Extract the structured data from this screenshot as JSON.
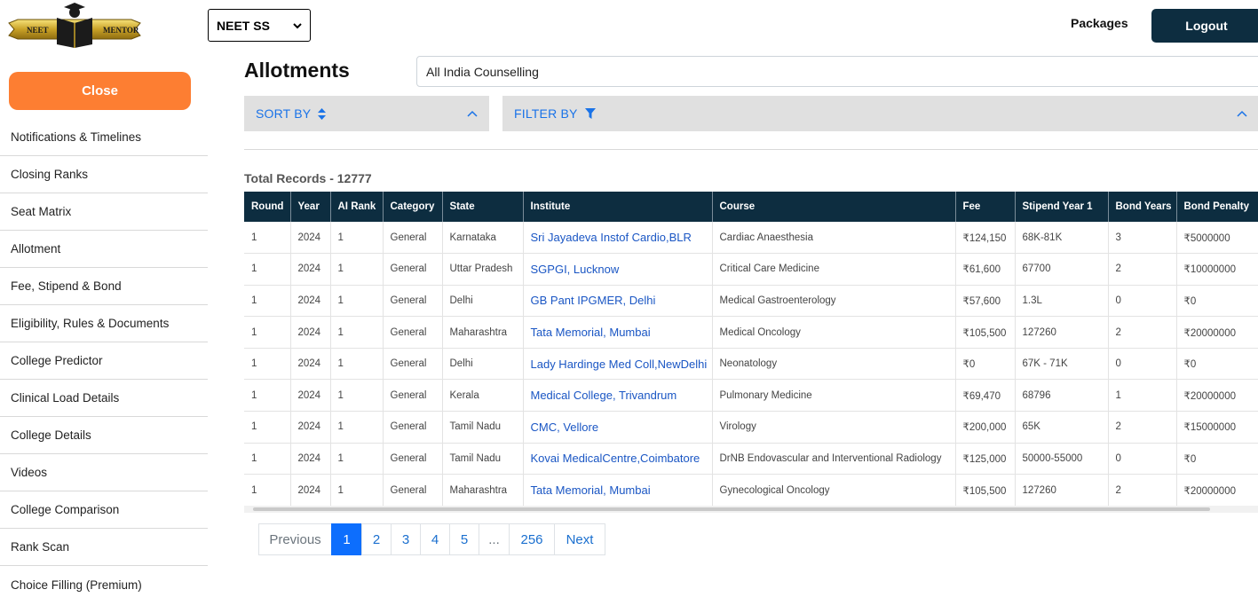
{
  "header": {
    "logo_left_text": "NEET",
    "logo_right_text": "MENTOR",
    "exam_select_value": "NEET SS",
    "packages_label": "Packages",
    "logout_label": "Logout"
  },
  "sidebar": {
    "close_label": "Close",
    "items": [
      {
        "label": "Notifications & Timelines"
      },
      {
        "label": "Closing Ranks"
      },
      {
        "label": "Seat Matrix"
      },
      {
        "label": "Allotment"
      },
      {
        "label": "Fee, Stipend & Bond"
      },
      {
        "label": "Eligibility, Rules & Documents"
      },
      {
        "label": "College Predictor"
      },
      {
        "label": "Clinical Load Details"
      },
      {
        "label": "College Details"
      },
      {
        "label": "Videos"
      },
      {
        "label": "College Comparison"
      },
      {
        "label": "Rank Scan"
      },
      {
        "label": "Choice Filling (Premium)"
      }
    ]
  },
  "main": {
    "title": "Allotments",
    "counselling_value": "All India Counselling",
    "sort_label": "SORT BY",
    "filter_label": "FILTER BY",
    "total_records": "Total Records - 12777"
  },
  "table": {
    "columns": [
      "Round",
      "Year",
      "AI Rank",
      "Category",
      "State",
      "Institute",
      "Course",
      "Fee",
      "Stipend Year 1",
      "Bond Years",
      "Bond Penalty"
    ],
    "rows": [
      [
        "1",
        "2024",
        "1",
        "General",
        "Karnataka",
        "Sri Jayadeva Instof Cardio,BLR",
        "Cardiac Anaesthesia",
        "₹124,150",
        "68K-81K",
        "3",
        "₹5000000"
      ],
      [
        "1",
        "2024",
        "1",
        "General",
        "Uttar Pradesh",
        "SGPGI, Lucknow",
        "Critical Care Medicine",
        "₹61,600",
        "67700",
        "2",
        "₹10000000"
      ],
      [
        "1",
        "2024",
        "1",
        "General",
        "Delhi",
        "GB Pant IPGMER, Delhi",
        "Medical Gastroenterology",
        "₹57,600",
        "1.3L",
        "0",
        "₹0"
      ],
      [
        "1",
        "2024",
        "1",
        "General",
        "Maharashtra",
        "Tata Memorial, Mumbai",
        "Medical Oncology",
        "₹105,500",
        "127260",
        "2",
        "₹20000000"
      ],
      [
        "1",
        "2024",
        "1",
        "General",
        "Delhi",
        "Lady Hardinge Med Coll,NewDelhi",
        "Neonatology",
        "₹0",
        "67K - 71K",
        "0",
        "₹0"
      ],
      [
        "1",
        "2024",
        "1",
        "General",
        "Kerala",
        "Medical College, Trivandrum",
        "Pulmonary Medicine",
        "₹69,470",
        "68796",
        "1",
        "₹20000000"
      ],
      [
        "1",
        "2024",
        "1",
        "General",
        "Tamil Nadu",
        "CMC, Vellore",
        "Virology",
        "₹200,000",
        "65K",
        "2",
        "₹15000000"
      ],
      [
        "1",
        "2024",
        "1",
        "General",
        "Tamil Nadu",
        "Kovai MedicalCentre,Coimbatore",
        "DrNB Endovascular and Interventional Radiology",
        "₹125,000",
        "50000-55000",
        "0",
        "₹0"
      ],
      [
        "1",
        "2024",
        "1",
        "General",
        "Maharashtra",
        "Tata Memorial, Mumbai",
        "Gynecological Oncology",
        "₹105,500",
        "127260",
        "2",
        "₹20000000"
      ]
    ]
  },
  "pagination": {
    "previous": "Previous",
    "pages": [
      "1",
      "2",
      "3",
      "4",
      "5",
      "...",
      "256"
    ],
    "active_page": "1",
    "next": "Next"
  },
  "colors": {
    "accent_orange": "#fd7e32",
    "navy": "#0d2d40",
    "link_blue": "#1a56c4",
    "active_page_blue": "#0d6efd"
  }
}
